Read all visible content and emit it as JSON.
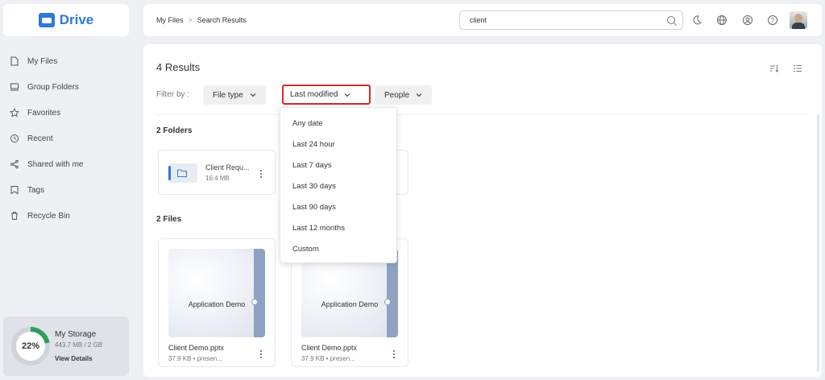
{
  "app": {
    "name": "Drive",
    "brand_color": "#2f7ad8"
  },
  "sidebar": {
    "items": [
      {
        "label": "My Files",
        "icon": "file-icon"
      },
      {
        "label": "Group Folders",
        "icon": "group-folder-icon"
      },
      {
        "label": "Favorites",
        "icon": "star-icon"
      },
      {
        "label": "Recent",
        "icon": "clock-icon"
      },
      {
        "label": "Shared with me",
        "icon": "share-icon"
      },
      {
        "label": "Tags",
        "icon": "tag-icon"
      },
      {
        "label": "Recycle Bin",
        "icon": "trash-icon"
      }
    ],
    "storage": {
      "percent_label": "22%",
      "percent": 22,
      "title": "My Storage",
      "usage": "443.7 MB / 2 GB",
      "link": "View Details",
      "ring_color": "#2e9e5a"
    }
  },
  "header": {
    "breadcrumb": {
      "root": "My Files",
      "separator": ">",
      "current": "Search Results"
    },
    "search": {
      "value": "client"
    },
    "icons": [
      "search-icon",
      "moon-icon",
      "globe-icon",
      "user-circle-icon",
      "help-icon",
      "avatar"
    ]
  },
  "main": {
    "results_title": "4 Results",
    "filter_label": "Filter by :",
    "filters": [
      {
        "label": "File type"
      },
      {
        "label": "Last modified",
        "active": true
      },
      {
        "label": "People"
      }
    ],
    "folders_title": "2 Folders",
    "folders": [
      {
        "name": "Client Requ...",
        "size": "16.4 MB"
      }
    ],
    "files_title": "2 Files",
    "files": [
      {
        "thumb_title": "Application Demo",
        "name": "Client Demo.pptx",
        "meta": "37.9 KB  •  presen..."
      },
      {
        "thumb_title": "Application Demo",
        "name": "Client Demo.pptx",
        "meta": "37.9 KB  •  presen..."
      }
    ]
  },
  "dropdown": {
    "options": [
      "Any date",
      "Last 24 hour",
      "Last 7 days",
      "Last 30 days",
      "Last 90 days",
      "Last 12 months",
      "Custom"
    ]
  },
  "highlight_color": "#d62a2a"
}
